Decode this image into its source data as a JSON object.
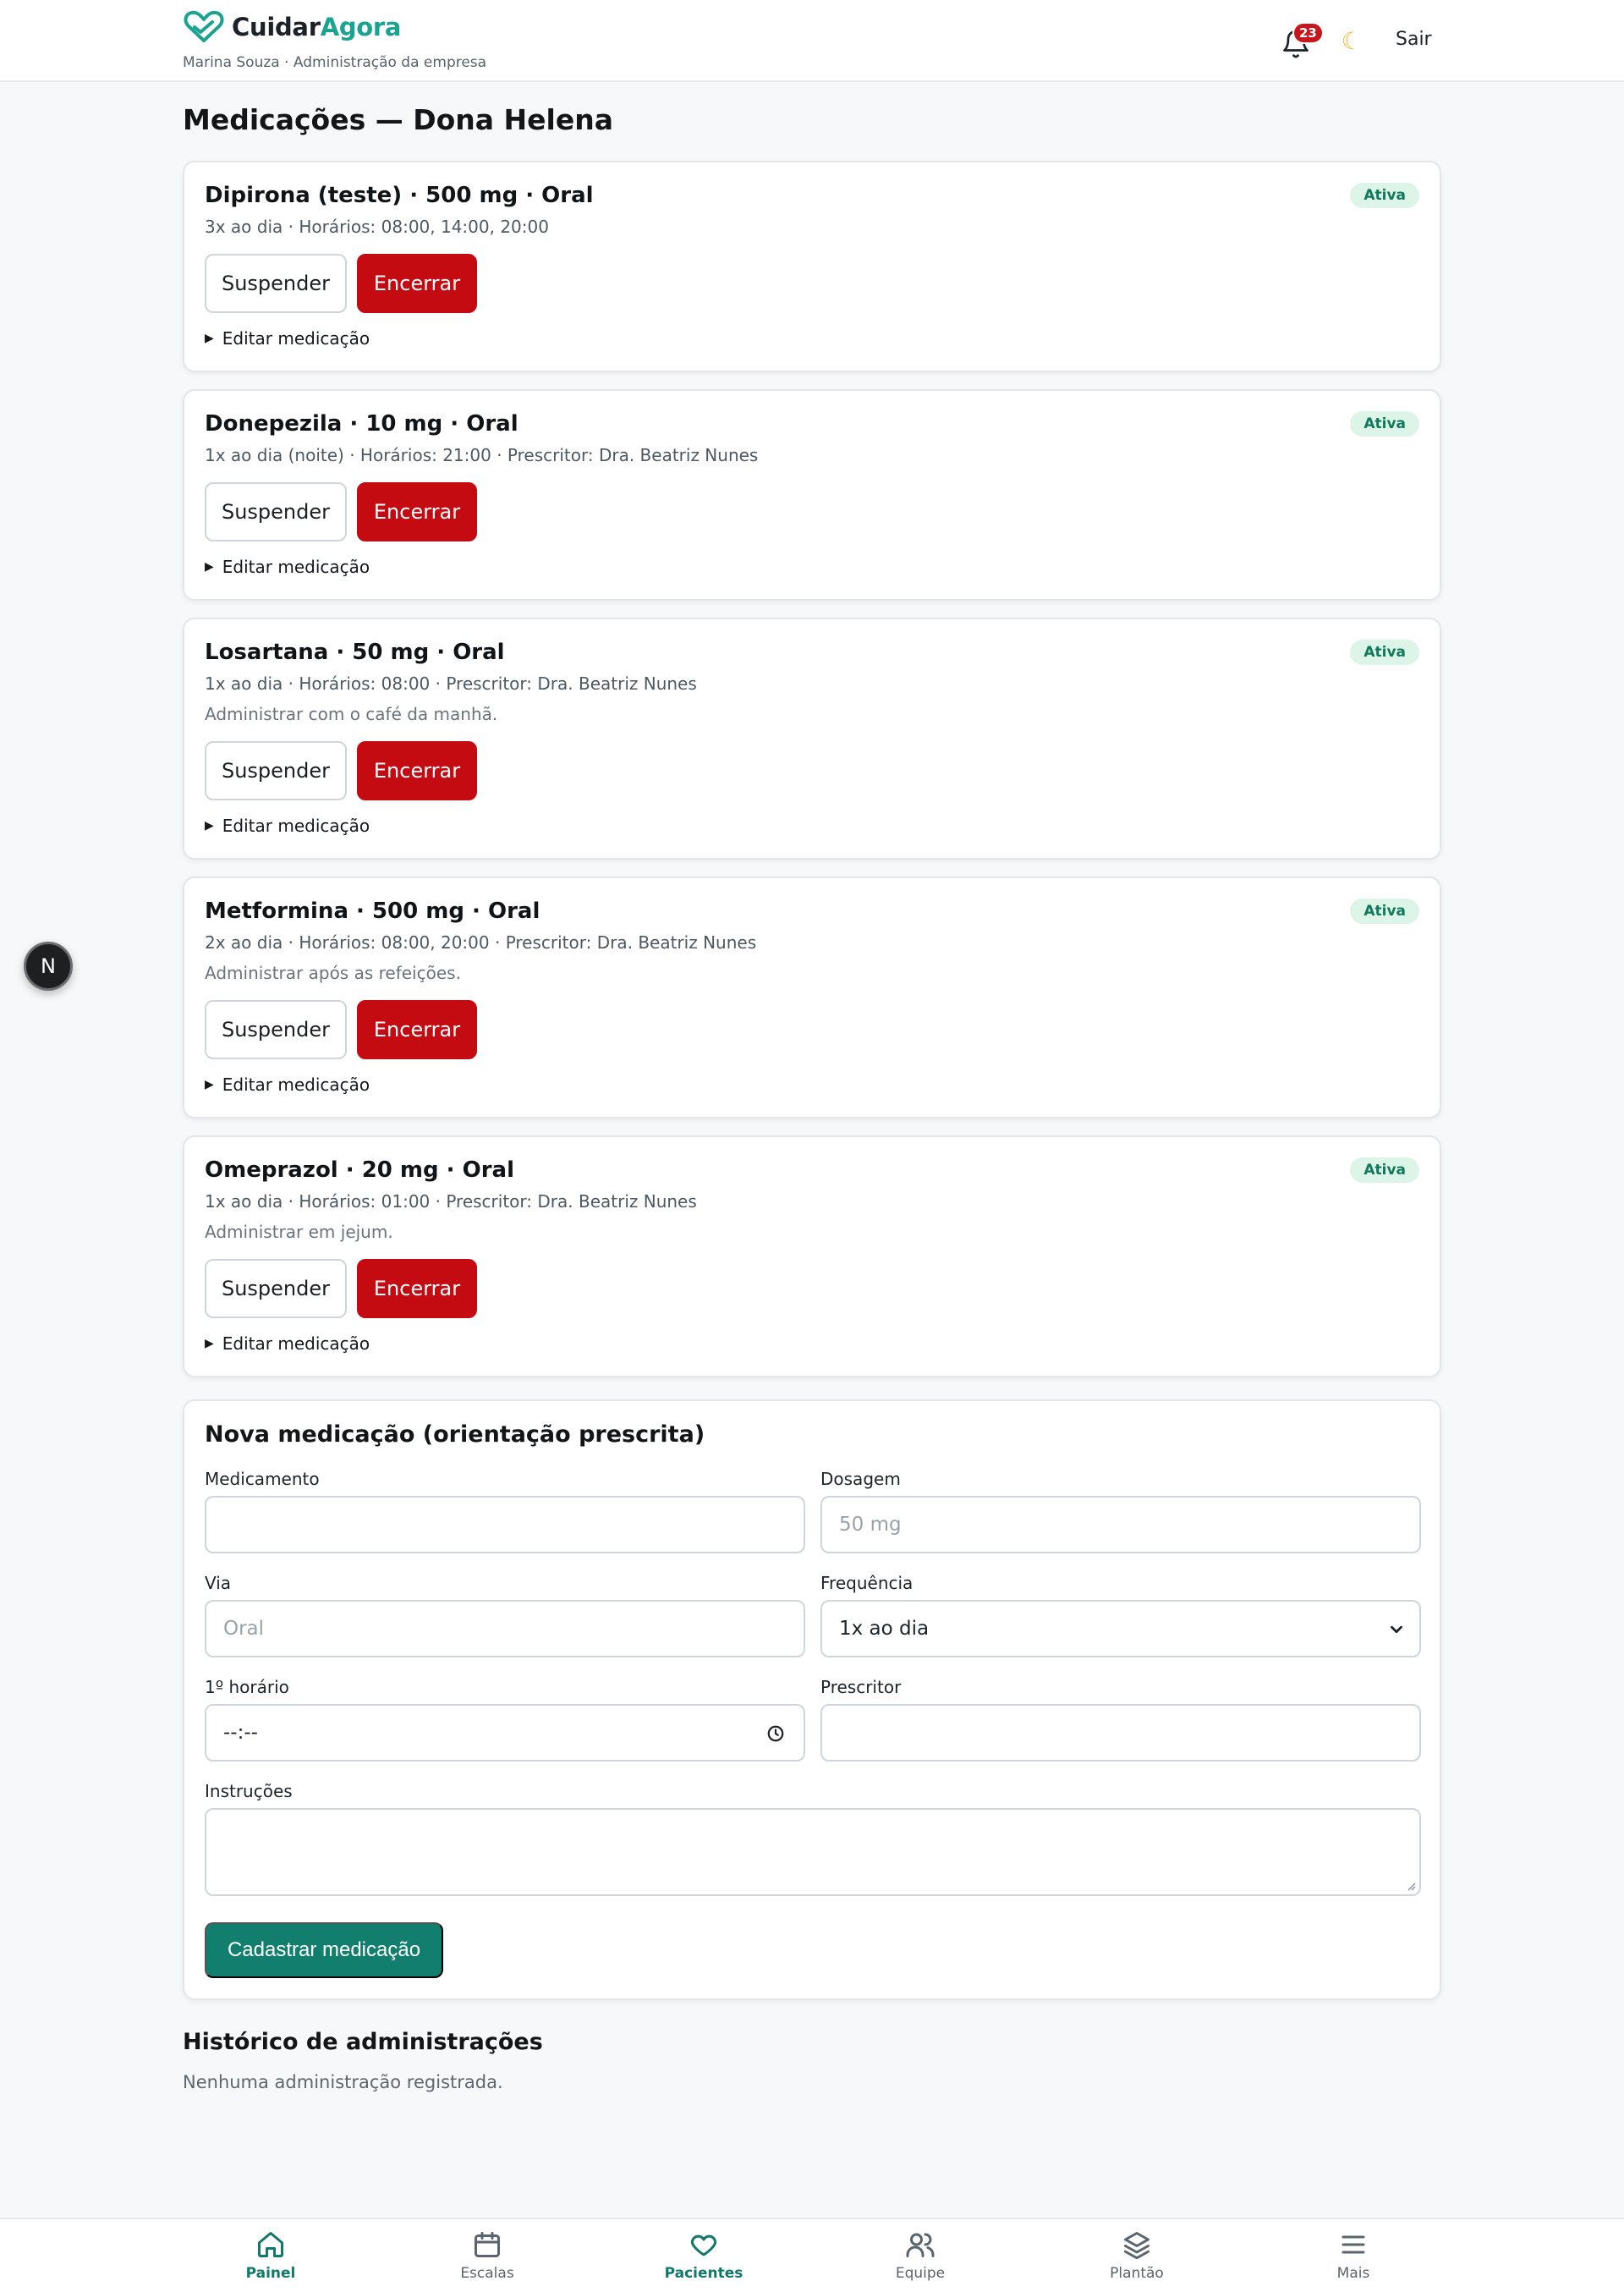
{
  "header": {
    "brand_part1": "Cuidar",
    "brand_part2": "Agora",
    "user_line": "Marina Souza · Administração da empresa",
    "notifications_count": "23",
    "theme_icon": "moon-icon",
    "logout_label": "Sair"
  },
  "page": {
    "title": "Medicações — Dona Helena"
  },
  "medications": [
    {
      "title": "Dipirona (teste) · 500 mg · Oral",
      "subtitle": "3x ao dia · Horários: 08:00, 14:00, 20:00",
      "note": "",
      "status": "Ativa",
      "suspend_label": "Suspender",
      "end_label": "Encerrar",
      "edit_label": "Editar medicação"
    },
    {
      "title": "Donepezila · 10 mg · Oral",
      "subtitle": "1x ao dia (noite) · Horários: 21:00 · Prescritor: Dra. Beatriz Nunes",
      "note": "",
      "status": "Ativa",
      "suspend_label": "Suspender",
      "end_label": "Encerrar",
      "edit_label": "Editar medicação"
    },
    {
      "title": "Losartana · 50 mg · Oral",
      "subtitle": "1x ao dia · Horários: 08:00 · Prescritor: Dra. Beatriz Nunes",
      "note": "Administrar com o café da manhã.",
      "status": "Ativa",
      "suspend_label": "Suspender",
      "end_label": "Encerrar",
      "edit_label": "Editar medicação"
    },
    {
      "title": "Metformina · 500 mg · Oral",
      "subtitle": "2x ao dia · Horários: 08:00, 20:00 · Prescritor: Dra. Beatriz Nunes",
      "note": "Administrar após as refeições.",
      "status": "Ativa",
      "suspend_label": "Suspender",
      "end_label": "Encerrar",
      "edit_label": "Editar medicação"
    },
    {
      "title": "Omeprazol · 20 mg · Oral",
      "subtitle": "1x ao dia · Horários: 01:00 · Prescritor: Dra. Beatriz Nunes",
      "note": "Administrar em jejum.",
      "status": "Ativa",
      "suspend_label": "Suspender",
      "end_label": "Encerrar",
      "edit_label": "Editar medicação"
    }
  ],
  "form": {
    "title": "Nova medicação (orientação prescrita)",
    "medicamento_label": "Medicamento",
    "medicamento_value": "",
    "dosagem_label": "Dosagem",
    "dosagem_placeholder": "50 mg",
    "via_label": "Via",
    "via_placeholder": "Oral",
    "frequencia_label": "Frequência",
    "frequencia_value": "1x ao dia",
    "horario_label": "1º horário",
    "horario_value": "--:--",
    "prescritor_label": "Prescritor",
    "prescritor_value": "",
    "instrucoes_label": "Instruções",
    "instrucoes_value": "",
    "submit_label": "Cadastrar medicação"
  },
  "history": {
    "title": "Histórico de administrações",
    "empty_text": "Nenhuma administração registrada."
  },
  "floating": {
    "label": "N"
  },
  "bottom_nav": [
    {
      "label": "Painel",
      "icon": "home-icon",
      "active": true
    },
    {
      "label": "Escalas",
      "icon": "calendar-icon",
      "active": false
    },
    {
      "label": "Pacientes",
      "icon": "heart-icon",
      "active": false
    },
    {
      "label": "Equipe",
      "icon": "users-icon",
      "active": false
    },
    {
      "label": "Plantão",
      "icon": "layers-icon",
      "active": false
    },
    {
      "label": "Mais",
      "icon": "menu-icon",
      "active": false
    }
  ],
  "colors": {
    "brand": "#1aa391",
    "primary": "#127e6e",
    "danger": "#c40b12",
    "active_badge_bg": "#dcf5e8",
    "active_badge_text": "#11795b"
  }
}
